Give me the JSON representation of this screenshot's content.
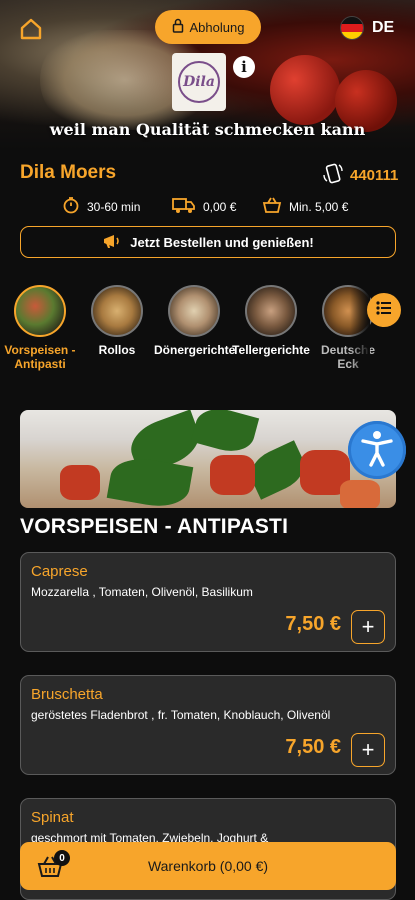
{
  "header": {
    "mode_label": "Abholung",
    "language": "DE",
    "slogan": "weil man Qualität schmecken kann",
    "logo_text": "Dila"
  },
  "restaurant": {
    "name": "Dila Moers",
    "phone": "440111",
    "delivery_time": "30-60 min",
    "delivery_fee": "0,00 €",
    "min_order": "Min. 5,00 €",
    "banner": "Jetzt Bestellen und genießen!"
  },
  "categories": [
    {
      "label": "Vorspeisen - Antipasti",
      "active": true
    },
    {
      "label": "Rollos",
      "active": false
    },
    {
      "label": "Dönergerichte",
      "active": false
    },
    {
      "label": "Tellergerichte",
      "active": false
    },
    {
      "label": "Deutsche Eck",
      "active": false
    }
  ],
  "section": {
    "title": "VORSPEISEN - ANTIPASTI"
  },
  "products": [
    {
      "name": "Caprese",
      "desc": "Mozzarella , Tomaten, Olivenöl, Basilikum",
      "price": "7,50 €"
    },
    {
      "name": "Bruschetta",
      "desc": "geröstetes Fladenbrot , fr. Tomaten, Knoblauch, Olivenöl",
      "price": "7,50 €"
    },
    {
      "name": "Spinat",
      "desc": "geschmort mit Tomaten, Zwiebeln, Joghurt &",
      "price": ""
    }
  ],
  "cart": {
    "label": "Warenkorb (0,00 €)",
    "count": "0"
  },
  "colors": {
    "accent": "#f7a52b",
    "background": "#0d0d0d",
    "card": "#2a2a2a",
    "accessibility": "#3a8ee6"
  }
}
